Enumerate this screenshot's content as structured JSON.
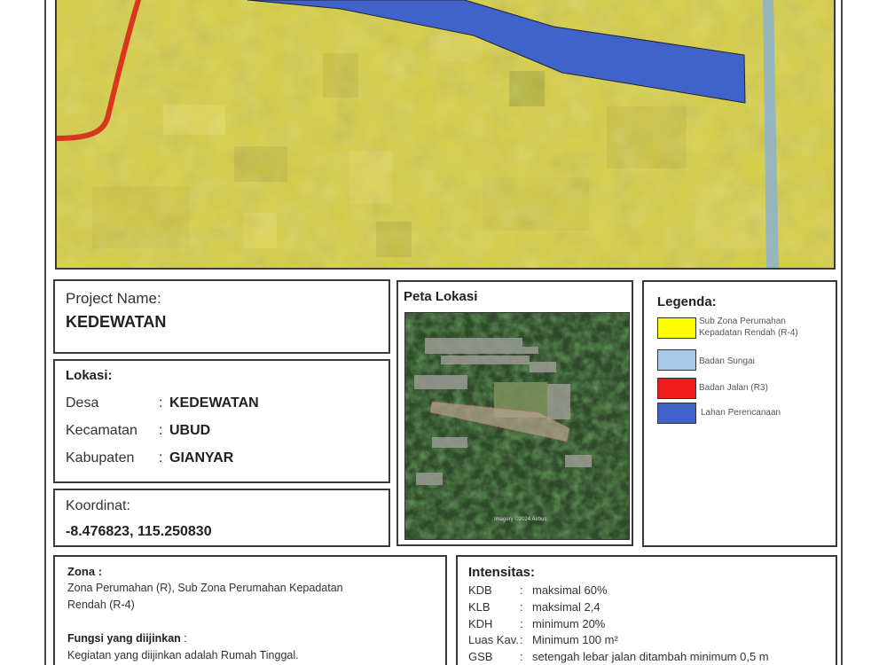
{
  "project": {
    "name_label": "Project Name:",
    "name_value": "KEDEWATAN"
  },
  "lokasi": {
    "title": "Lokasi:",
    "rows": [
      {
        "key": "Desa",
        "value": "KEDEWATAN"
      },
      {
        "key": "Kecamatan",
        "value": "UBUD"
      },
      {
        "key": "Kabupaten",
        "value": "GIANYAR"
      }
    ]
  },
  "koordinat": {
    "label": "Koordinat:",
    "value": "-8.476823, 115.250830"
  },
  "peta_lokasi": {
    "title": "Peta Lokasi",
    "imagery_credit": "Imagery ©2024 Airbus"
  },
  "legenda": {
    "title": "Legenda:",
    "items": [
      {
        "label_lines": [
          "Sub Zona Perumahan",
          "Kepadatan Rendah (R-4)"
        ],
        "color": "#ffff00"
      },
      {
        "label_lines": [
          "Badan Sungai"
        ],
        "color": "#a9c9ea"
      },
      {
        "label_lines": [
          "Badan Jalan (R3)"
        ],
        "color": "#ee1c1c"
      },
      {
        "label_lines": [
          "Lahan Perencanaan"
        ],
        "color": "#3f63c8"
      }
    ]
  },
  "zona": {
    "title": "Zona",
    "colon": ":",
    "text_lines": [
      "Zona Perumahan (R), Sub Zona Perumahan Kepadatan",
      "Rendah (R-4)"
    ]
  },
  "fungsi": {
    "title": "Fungsi yang diijinkan",
    "colon": ":",
    "text": "Kegiatan yang diijinkan adalah Rumah Tinggal."
  },
  "intensitas": {
    "title": "Intensitas:",
    "rows": [
      {
        "key": "KDB",
        "value": "maksimal 60%"
      },
      {
        "key": "KLB",
        "value": "maksimal 2,4"
      },
      {
        "key": "KDH",
        "value": "minimum 20%"
      },
      {
        "key": "Luas Kav.",
        "value": "Minimum 100 m²"
      },
      {
        "key": "GSB",
        "value": "setengah lebar jalan ditambah minimum 0,5 m"
      }
    ]
  },
  "map_colors": {
    "zone": "#d7cf45",
    "plot": "#3f63c8",
    "road": "#d8371e",
    "river": "#8fb4c8"
  }
}
